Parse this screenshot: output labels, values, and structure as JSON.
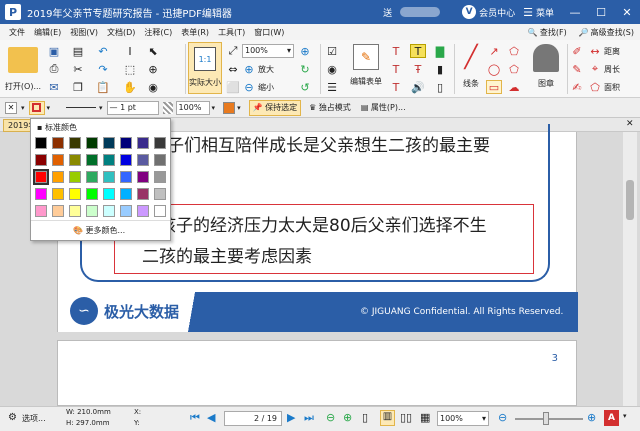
{
  "titlebar": {
    "title": "2019年父亲节专题研究报告 - 迅捷PDF编辑器",
    "logo": "P",
    "user_partial": "送",
    "vip_badge": "V",
    "vip_label": "会员中心",
    "menu_label": "菜单",
    "min": "—",
    "max": "☐",
    "close": "✕"
  },
  "menubar": {
    "items": [
      "文件",
      "编辑(E)",
      "视图(V)",
      "文档(D)",
      "注释(C)",
      "表单(R)",
      "工具(T)",
      "窗口(W)"
    ],
    "find": "查找(F)",
    "adv_find": "高级查找(S)"
  },
  "ribbon": {
    "open": "打开(O)...",
    "actual_size": "实际大小",
    "zoom_value": "100%",
    "zoom_in": "放大",
    "zoom_out": "缩小",
    "edit_form": "编辑表单",
    "line": "线条",
    "stamp": "图章",
    "distance": "距离",
    "perimeter": "周长",
    "area": "面积"
  },
  "toolbar2": {
    "x_mark": "✕",
    "line_width": "1 pt",
    "opacity": "100%",
    "keep_select": "保持选定",
    "exclusive": "独占模式",
    "properties": "属性(P)..."
  },
  "tab": {
    "label": "2019年"
  },
  "doc": {
    "line1": "父子们相互陪伴成长是父亲想生二孩的最主要",
    "line2": "因",
    "box_line1": "养孩子的经济压力太大是80后父亲们选择不生",
    "box_line2": "二孩的最主要考虑因素",
    "brand": "极光大数据",
    "copyright": "© JIGUANG Confidential. All Rights Reserved.",
    "page_number": "3"
  },
  "color_popup": {
    "header": "标准颜色",
    "more": "更多颜色...",
    "rows": [
      [
        "#000000",
        "#8c2f00",
        "#3a3a00",
        "#003b00",
        "#003a5a",
        "#00007a",
        "#3a2b8c",
        "#3a3a3a"
      ],
      [
        "#8a0000",
        "#e06000",
        "#8a8a00",
        "#00702a",
        "#008080",
        "#0000e0",
        "#5a5aa0",
        "#707070"
      ],
      [
        "#ff0000",
        "#ffa000",
        "#99cc00",
        "#2eaa60",
        "#30c0c0",
        "#3366ff",
        "#800080",
        "#999999"
      ],
      [
        "#ff00ff",
        "#ffc000",
        "#ffff00",
        "#00ff00",
        "#00ffff",
        "#00b0ff",
        "#993366",
        "#c0c0c0"
      ],
      [
        "#ff99cc",
        "#ffcc99",
        "#ffff99",
        "#ccffcc",
        "#ccffff",
        "#99ccff",
        "#cc99ff",
        "#ffffff"
      ]
    ]
  },
  "status": {
    "select": "选项...",
    "w": "W: 210.0mm",
    "h": "H: 297.0mm",
    "x": "X:",
    "y": "Y:",
    "page_value": "2",
    "page_total": "/ 19",
    "zoom": "100%"
  },
  "colors": {
    "title": "#2b5ea7",
    "brand_blue": "#2b5ea7",
    "box_red": "#d9343a"
  }
}
